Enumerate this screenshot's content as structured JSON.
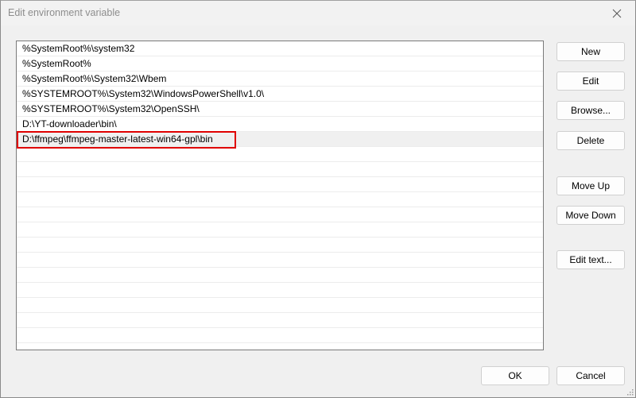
{
  "window": {
    "title": "Edit environment variable"
  },
  "list": {
    "items": [
      {
        "value": "%SystemRoot%\\system32"
      },
      {
        "value": "%SystemRoot%"
      },
      {
        "value": "%SystemRoot%\\System32\\Wbem"
      },
      {
        "value": "%SYSTEMROOT%\\System32\\WindowsPowerShell\\v1.0\\"
      },
      {
        "value": "%SYSTEMROOT%\\System32\\OpenSSH\\"
      },
      {
        "value": "D:\\YT-downloader\\bin\\"
      },
      {
        "value": "D:\\ffmpeg\\ffmpeg-master-latest-win64-gpl\\bin",
        "selected": true,
        "highlighted": true
      }
    ],
    "empty_rows": 14,
    "highlight_color": "#e00000"
  },
  "buttons": {
    "new": "New",
    "edit": "Edit",
    "browse": "Browse...",
    "delete": "Delete",
    "move_up": "Move Up",
    "move_down": "Move Down",
    "edit_text": "Edit text...",
    "ok": "OK",
    "cancel": "Cancel"
  },
  "icons": {
    "close": "close-icon",
    "resize_grip": "resize-grip-icon"
  }
}
